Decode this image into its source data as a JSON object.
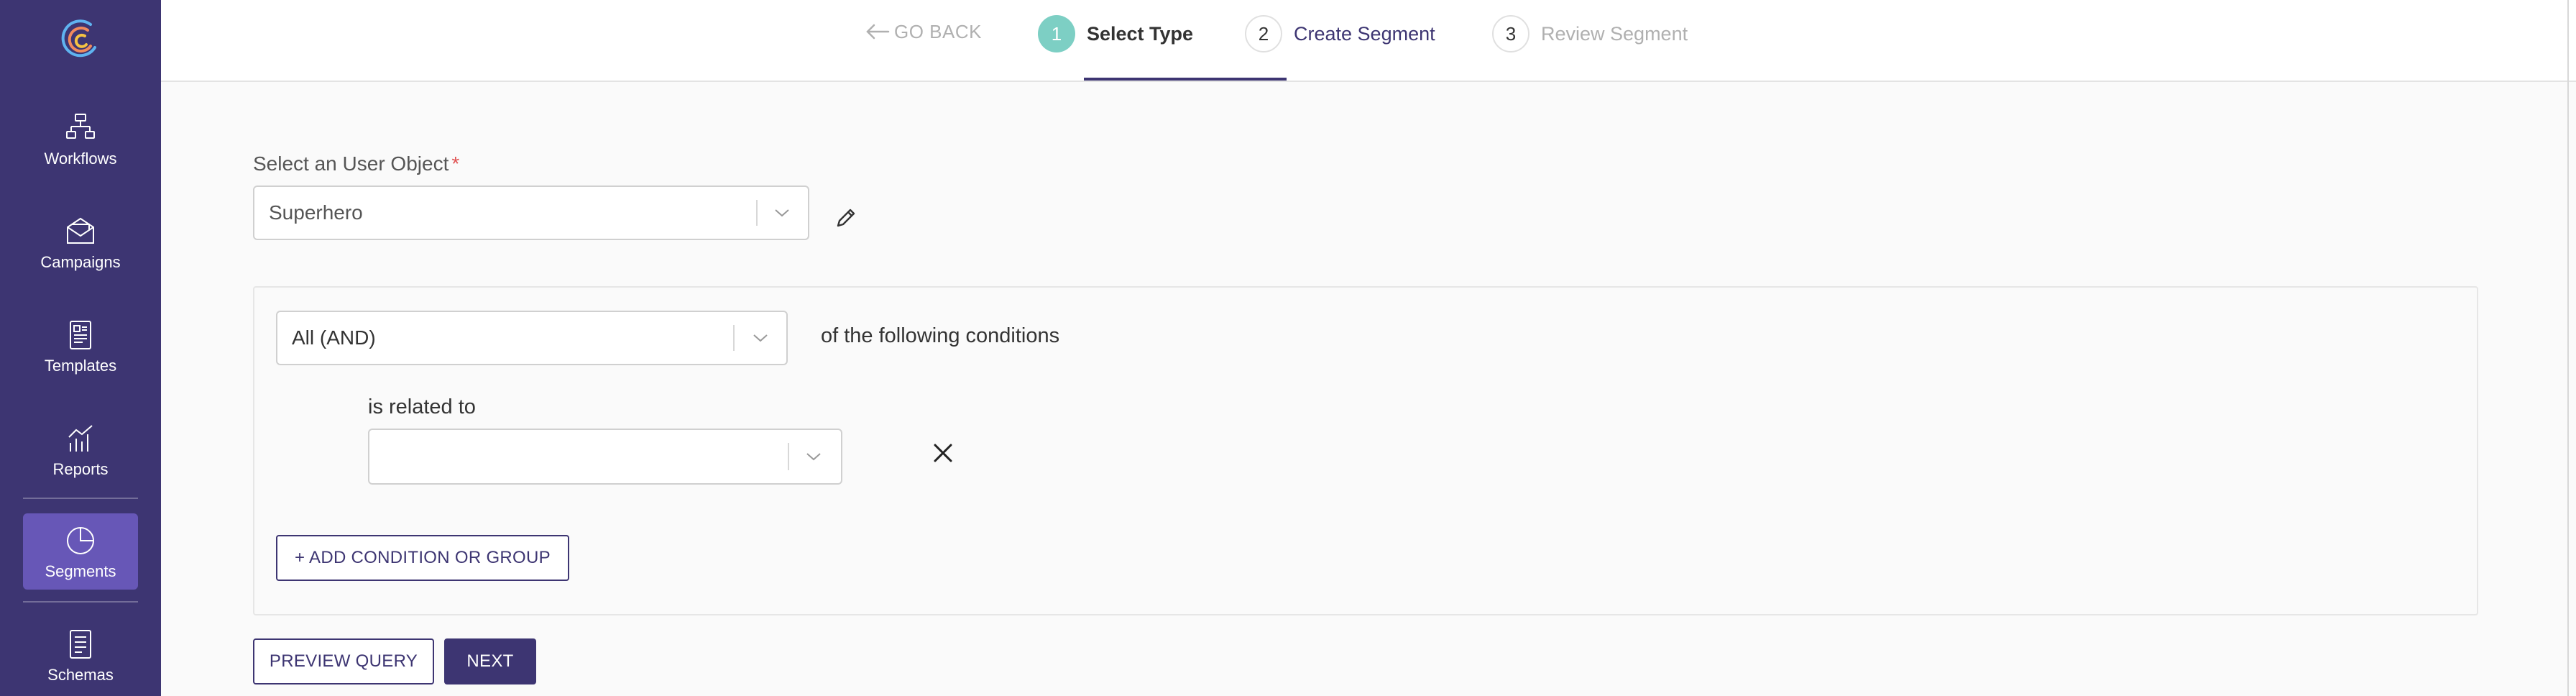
{
  "sidebar": {
    "items": [
      {
        "label": "Workflows",
        "icon": "workflow-icon"
      },
      {
        "label": "Campaigns",
        "icon": "envelope-icon"
      },
      {
        "label": "Templates",
        "icon": "template-icon"
      },
      {
        "label": "Reports",
        "icon": "chart-icon"
      },
      {
        "label": "Segments",
        "icon": "pie-chart-icon",
        "active": true
      },
      {
        "label": "Schemas",
        "icon": "document-icon"
      }
    ]
  },
  "header": {
    "go_back": "GO BACK",
    "steps": [
      {
        "number": "1",
        "label": "Select Type",
        "state": "completed"
      },
      {
        "number": "2",
        "label": "Create Segment",
        "state": "active"
      },
      {
        "number": "3",
        "label": "Review Segment",
        "state": "upcoming"
      }
    ]
  },
  "form": {
    "object_label": "Select an User Object",
    "required_mark": "*",
    "object_value": "Superhero",
    "match_value": "All (AND)",
    "match_suffix": "of the following conditions",
    "condition_label": "is related to",
    "condition_value": "",
    "add_condition": "+ ADD CONDITION OR GROUP",
    "preview_query": "PREVIEW QUERY",
    "next": "NEXT"
  },
  "colors": {
    "brand": "#3d3572",
    "active_nav": "#6757b7",
    "step_complete": "#7dcfc4",
    "required": "#e05252"
  }
}
